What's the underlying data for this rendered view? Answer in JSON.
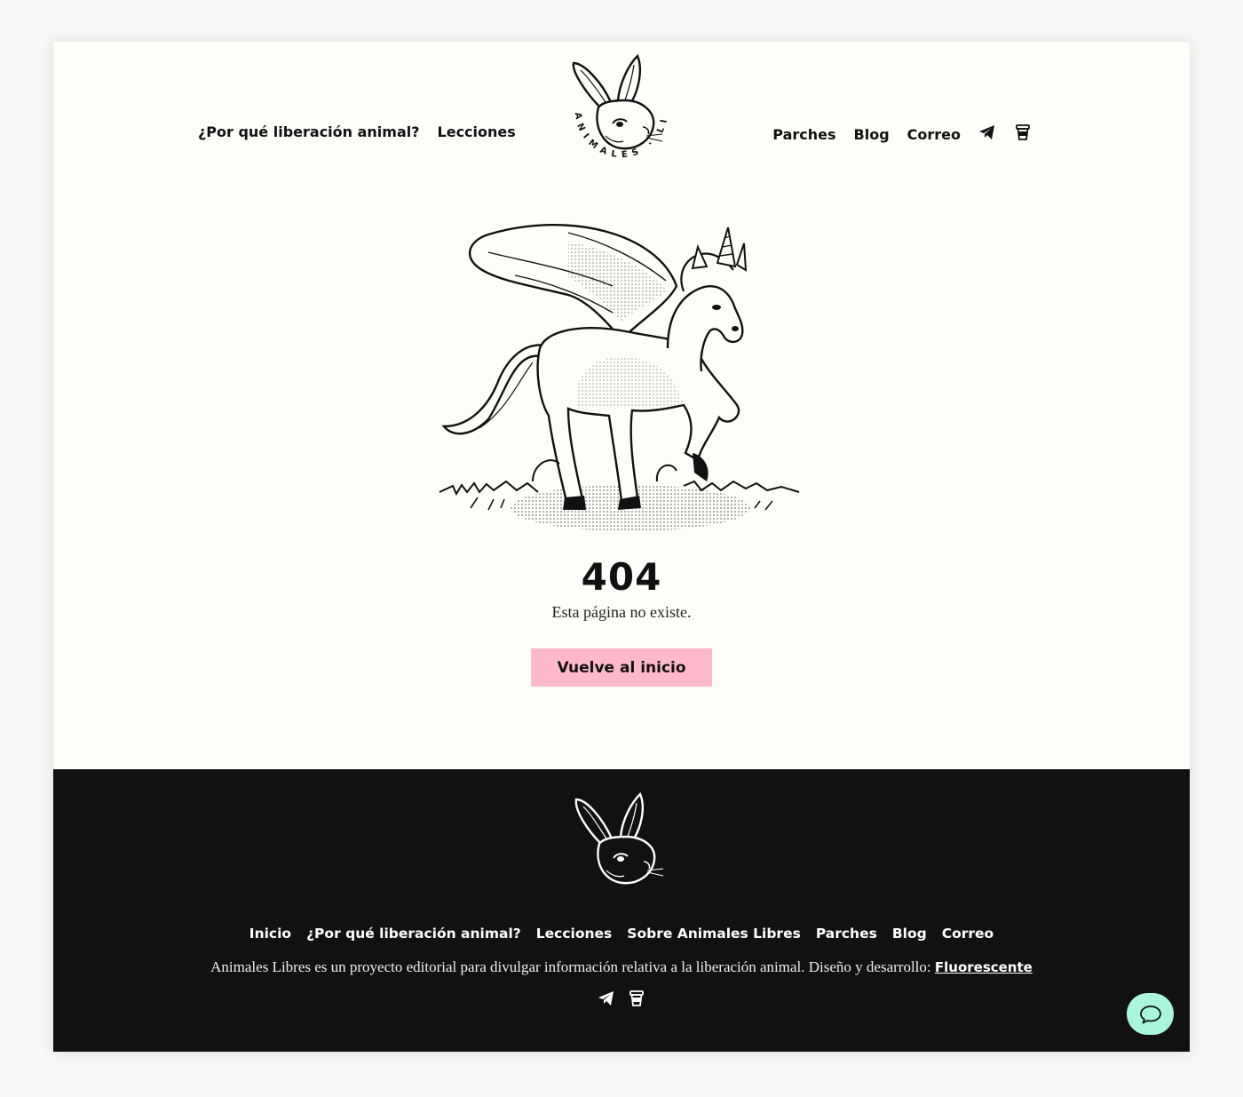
{
  "header": {
    "logo_text": "ANIMALES · LIBRES",
    "nav_left": [
      {
        "label": "¿Por qué liberación animal?"
      },
      {
        "label": "Lecciones"
      }
    ],
    "nav_right": [
      {
        "label": "Parches"
      },
      {
        "label": "Blog"
      },
      {
        "label": "Correo"
      }
    ],
    "icons": [
      "telegram-icon",
      "cup-icon"
    ]
  },
  "main": {
    "illustration": "winged-unicorn-illustration",
    "code": "404",
    "message": "Esta página no existe.",
    "button_label": "Vuelve al inicio",
    "button_color": "#ffb9cb"
  },
  "footer": {
    "links": [
      {
        "label": "Inicio"
      },
      {
        "label": "¿Por qué liberación animal?"
      },
      {
        "label": "Lecciones"
      },
      {
        "label": "Sobre Animales Libres"
      },
      {
        "label": "Parches"
      },
      {
        "label": "Blog"
      },
      {
        "label": "Correo"
      }
    ],
    "description": "Animales Libres es un proyecto editorial para divulgar información relativa a la liberación animal. Diseño y desarrollo: ",
    "credit": "Fluorescente",
    "icons": [
      "telegram-icon",
      "cup-icon"
    ],
    "background": "#111111"
  },
  "chat": {
    "icon": "chat-bubble-icon",
    "color": "#a9f6dc"
  }
}
